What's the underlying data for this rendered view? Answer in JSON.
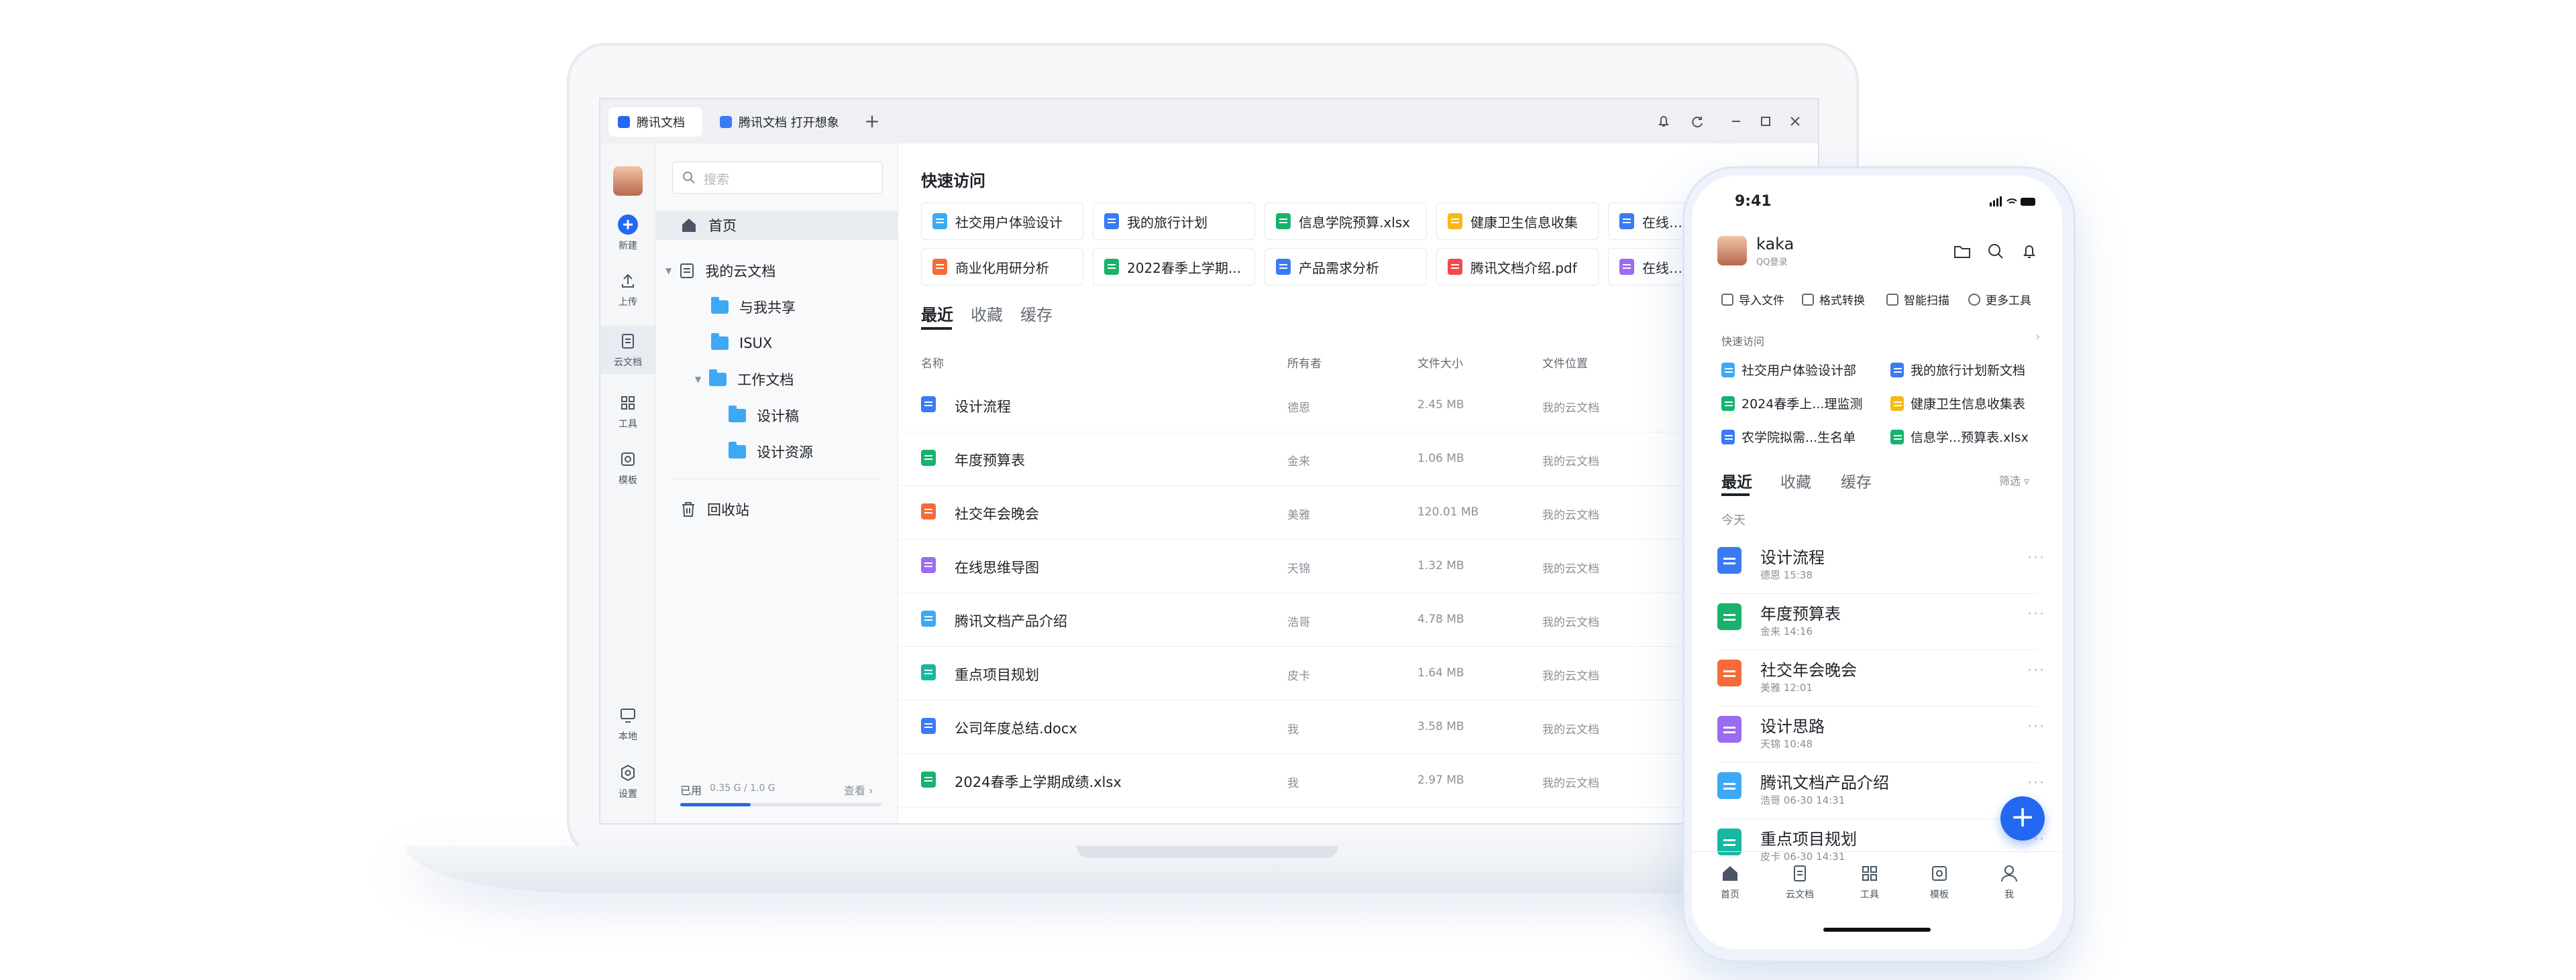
{
  "colors": {
    "accent": "#2468f2",
    "doc": "#3a7af5",
    "sheet": "#18b26b",
    "slide": "#f56b3a",
    "mind": "#9b6cf0",
    "pdf": "#f04a4a",
    "form": "#f5b91a",
    "board": "#16b8a3",
    "word": "#3a7af5",
    "folder": "#3da9f5"
  },
  "desktop": {
    "tabs": [
      {
        "label": "腾讯文档",
        "icon": "tencent-docs-logo-icon"
      },
      {
        "label": "腾讯文档 打开想象",
        "icon": "doc-icon"
      }
    ],
    "new_tab_symbol": "+",
    "rail": [
      {
        "label": "新建",
        "icon": "plus-circle-icon"
      },
      {
        "label": "上传",
        "icon": "upload-icon"
      },
      {
        "label": "云文档",
        "icon": "cloud-doc-icon"
      },
      {
        "label": "工具",
        "icon": "grid-tools-icon"
      },
      {
        "label": "模板",
        "icon": "template-icon"
      },
      {
        "label": "本地",
        "icon": "monitor-icon"
      },
      {
        "label": "设置",
        "icon": "settings-icon"
      }
    ],
    "search_placeholder": "搜索",
    "tree": {
      "home": "首页",
      "my_cloud": "我的云文档",
      "shared": "与我共享",
      "isux": "ISUX",
      "work": "工作文档",
      "design_draft": "设计稿",
      "design_res": "设计资源",
      "trash": "回收站"
    },
    "storage": {
      "used_label": "已用",
      "amount": "0.35 G / 1.0 G",
      "view": "查看",
      "fraction": 0.35
    },
    "quick_access_title": "快速访问",
    "quick_access": [
      {
        "label": "社交用户体验设计",
        "type": "folder"
      },
      {
        "label": "我的旅行计划",
        "type": "doc"
      },
      {
        "label": "信息学院预算.xlsx",
        "type": "excel"
      },
      {
        "label": "健康卫生信息收集",
        "type": "form"
      },
      {
        "label": "在线…",
        "type": "doc"
      },
      {
        "label": "商业化用研分析",
        "type": "slide"
      },
      {
        "label": "2022春季上学期...",
        "type": "sheet"
      },
      {
        "label": "产品需求分析",
        "type": "doc"
      },
      {
        "label": "腾讯文档介绍.pdf",
        "type": "pdf"
      },
      {
        "label": "在线…",
        "type": "mind"
      }
    ],
    "file_tabs": [
      "最近",
      "收藏",
      "缓存"
    ],
    "columns": {
      "name": "名称",
      "owner": "所有者",
      "size": "文件大小",
      "location": "文件位置"
    },
    "files": [
      {
        "name": "设计流程",
        "owner": "德恩",
        "size": "2.45 MB",
        "location": "我的云文档",
        "type": "doc"
      },
      {
        "name": "年度预算表",
        "owner": "金来",
        "size": "1.06 MB",
        "location": "我的云文档",
        "type": "sheet"
      },
      {
        "name": "社交年会晚会",
        "owner": "美雅",
        "size": "120.01 MB",
        "location": "我的云文档",
        "type": "slide"
      },
      {
        "name": "在线思维导图",
        "owner": "天锦",
        "size": "1.32 MB",
        "location": "我的云文档",
        "type": "mind"
      },
      {
        "name": "腾讯文档产品介绍",
        "owner": "浩哥",
        "size": "4.78 MB",
        "location": "我的云文档",
        "type": "folder"
      },
      {
        "name": "重点项目规划",
        "owner": "皮卡",
        "size": "1.64 MB",
        "location": "我的云文档",
        "type": "board"
      },
      {
        "name": "公司年度总结.docx",
        "owner": "我",
        "size": "3.58 MB",
        "location": "我的云文档",
        "type": "word"
      },
      {
        "name": "2024春季上学期成绩.xlsx",
        "owner": "我",
        "size": "2.97 MB",
        "location": "我的云文档",
        "type": "excel"
      }
    ]
  },
  "phone": {
    "time": "9:41",
    "user": {
      "name": "kaka",
      "sub": "QQ登录"
    },
    "tools": [
      "导入文件",
      "格式转换",
      "智能扫描",
      "更多工具"
    ],
    "quick_title": "快速访问",
    "quick": [
      {
        "label": "社交用户体验设计部",
        "type": "folder"
      },
      {
        "label": "我的旅行计划新文档",
        "type": "doc"
      },
      {
        "label": "2024春季上...理监测",
        "type": "sheet"
      },
      {
        "label": "健康卫生信息收集表",
        "type": "form"
      },
      {
        "label": "农学院拟需...生名单",
        "type": "doc"
      },
      {
        "label": "信息学...预算表.xlsx",
        "type": "excel"
      }
    ],
    "tabs": [
      "最近",
      "收藏",
      "缓存"
    ],
    "filter": "筛选",
    "today": "今天",
    "files": [
      {
        "name": "设计流程",
        "meta": "德恩 15:38",
        "type": "doc"
      },
      {
        "name": "年度预算表",
        "meta": "金来 14:16",
        "type": "sheet"
      },
      {
        "name": "社交年会晚会",
        "meta": "美雅 12:01",
        "type": "slide"
      },
      {
        "name": "设计思路",
        "meta": "天锦 10:48",
        "type": "mind"
      },
      {
        "name": "腾讯文档产品介绍",
        "meta": "浩哥 06-30 14:31",
        "type": "folder"
      },
      {
        "name": "重点项目规划",
        "meta": "皮卡 06-30 14:31",
        "type": "board"
      }
    ],
    "nav": [
      "首页",
      "云文档",
      "工具",
      "模板",
      "我"
    ],
    "fab_symbol": "+"
  }
}
